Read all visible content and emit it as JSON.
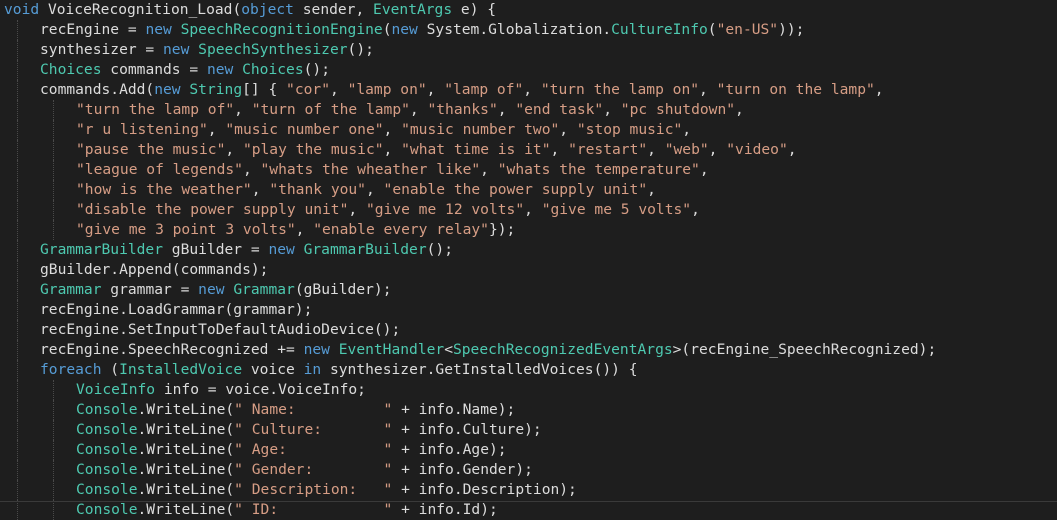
{
  "editor": {
    "theme_colors": {
      "background": "#1e1e1e",
      "keyword": "#569cd6",
      "type": "#4ec9b0",
      "string": "#d69d85",
      "text": "#dcdcdc"
    },
    "lines": [
      {
        "indent": 0,
        "tokens": [
          [
            "kw",
            "void"
          ],
          [
            "tx",
            " VoiceRecognition_Load("
          ],
          [
            "kw",
            "object"
          ],
          [
            "tx",
            " sender, "
          ],
          [
            "ty",
            "EventArgs"
          ],
          [
            "tx",
            " e) {"
          ]
        ]
      },
      {
        "indent": 1,
        "tokens": [
          [
            "tx",
            "recEngine = "
          ],
          [
            "kw",
            "new"
          ],
          [
            "tx",
            " "
          ],
          [
            "ty",
            "SpeechRecognitionEngine"
          ],
          [
            "tx",
            "("
          ],
          [
            "kw",
            "new"
          ],
          [
            "tx",
            " System.Globalization."
          ],
          [
            "ty",
            "CultureInfo"
          ],
          [
            "tx",
            "("
          ],
          [
            "st",
            "\"en-US\""
          ],
          [
            "tx",
            "));"
          ]
        ]
      },
      {
        "indent": 1,
        "tokens": [
          [
            "tx",
            "synthesizer = "
          ],
          [
            "kw",
            "new"
          ],
          [
            "tx",
            " "
          ],
          [
            "ty",
            "SpeechSynthesizer"
          ],
          [
            "tx",
            "();"
          ]
        ]
      },
      {
        "indent": 1,
        "tokens": [
          [
            "ty",
            "Choices"
          ],
          [
            "tx",
            " commands = "
          ],
          [
            "kw",
            "new"
          ],
          [
            "tx",
            " "
          ],
          [
            "ty",
            "Choices"
          ],
          [
            "tx",
            "();"
          ]
        ]
      },
      {
        "indent": 1,
        "tokens": [
          [
            "tx",
            "commands.Add("
          ],
          [
            "kw",
            "new"
          ],
          [
            "tx",
            " "
          ],
          [
            "ty",
            "String"
          ],
          [
            "tx",
            "[] { "
          ],
          [
            "st",
            "\"cor\""
          ],
          [
            "tx",
            ", "
          ],
          [
            "st",
            "\"lamp on\""
          ],
          [
            "tx",
            ", "
          ],
          [
            "st",
            "\"lamp of\""
          ],
          [
            "tx",
            ", "
          ],
          [
            "st",
            "\"turn the lamp on\""
          ],
          [
            "tx",
            ", "
          ],
          [
            "st",
            "\"turn on the lamp\""
          ],
          [
            "tx",
            ","
          ]
        ]
      },
      {
        "indent": 2,
        "tokens": [
          [
            "st",
            "\"turn the lamp of\""
          ],
          [
            "tx",
            ", "
          ],
          [
            "st",
            "\"turn of the lamp\""
          ],
          [
            "tx",
            ", "
          ],
          [
            "st",
            "\"thanks\""
          ],
          [
            "tx",
            ", "
          ],
          [
            "st",
            "\"end task\""
          ],
          [
            "tx",
            ", "
          ],
          [
            "st",
            "\"pc shutdown\""
          ],
          [
            "tx",
            ","
          ]
        ]
      },
      {
        "indent": 2,
        "tokens": [
          [
            "st",
            "\"r u listening\""
          ],
          [
            "tx",
            ", "
          ],
          [
            "st",
            "\"music number one\""
          ],
          [
            "tx",
            ", "
          ],
          [
            "st",
            "\"music number two\""
          ],
          [
            "tx",
            ", "
          ],
          [
            "st",
            "\"stop music\""
          ],
          [
            "tx",
            ","
          ]
        ]
      },
      {
        "indent": 2,
        "tokens": [
          [
            "st",
            "\"pause the music\""
          ],
          [
            "tx",
            ", "
          ],
          [
            "st",
            "\"play the music\""
          ],
          [
            "tx",
            ", "
          ],
          [
            "st",
            "\"what time is it\""
          ],
          [
            "tx",
            ", "
          ],
          [
            "st",
            "\"restart\""
          ],
          [
            "tx",
            ", "
          ],
          [
            "st",
            "\"web\""
          ],
          [
            "tx",
            ", "
          ],
          [
            "st",
            "\"video\""
          ],
          [
            "tx",
            ","
          ]
        ]
      },
      {
        "indent": 2,
        "tokens": [
          [
            "st",
            "\"league of legends\""
          ],
          [
            "tx",
            ", "
          ],
          [
            "st",
            "\"whats the wheather like\""
          ],
          [
            "tx",
            ", "
          ],
          [
            "st",
            "\"whats the temperature\""
          ],
          [
            "tx",
            ","
          ]
        ]
      },
      {
        "indent": 2,
        "tokens": [
          [
            "st",
            "\"how is the weather\""
          ],
          [
            "tx",
            ", "
          ],
          [
            "st",
            "\"thank you\""
          ],
          [
            "tx",
            ", "
          ],
          [
            "st",
            "\"enable the power supply unit\""
          ],
          [
            "tx",
            ","
          ]
        ]
      },
      {
        "indent": 2,
        "tokens": [
          [
            "st",
            "\"disable the power supply unit\""
          ],
          [
            "tx",
            ", "
          ],
          [
            "st",
            "\"give me 12 volts\""
          ],
          [
            "tx",
            ", "
          ],
          [
            "st",
            "\"give me 5 volts\""
          ],
          [
            "tx",
            ","
          ]
        ]
      },
      {
        "indent": 2,
        "tokens": [
          [
            "st",
            "\"give me 3 point 3 volts\""
          ],
          [
            "tx",
            ", "
          ],
          [
            "st",
            "\"enable every relay\""
          ],
          [
            "tx",
            "});"
          ]
        ]
      },
      {
        "indent": 1,
        "tokens": [
          [
            "ty",
            "GrammarBuilder"
          ],
          [
            "tx",
            " gBuilder = "
          ],
          [
            "kw",
            "new"
          ],
          [
            "tx",
            " "
          ],
          [
            "ty",
            "GrammarBuilder"
          ],
          [
            "tx",
            "();"
          ]
        ]
      },
      {
        "indent": 1,
        "tokens": [
          [
            "tx",
            "gBuilder.Append(commands);"
          ]
        ]
      },
      {
        "indent": 1,
        "tokens": [
          [
            "ty",
            "Grammar"
          ],
          [
            "tx",
            " grammar = "
          ],
          [
            "kw",
            "new"
          ],
          [
            "tx",
            " "
          ],
          [
            "ty",
            "Grammar"
          ],
          [
            "tx",
            "(gBuilder);"
          ]
        ]
      },
      {
        "indent": 1,
        "tokens": [
          [
            "tx",
            "recEngine.LoadGrammar(grammar);"
          ]
        ]
      },
      {
        "indent": 1,
        "tokens": [
          [
            "tx",
            "recEngine.SetInputToDefaultAudioDevice();"
          ]
        ]
      },
      {
        "indent": 1,
        "tokens": [
          [
            "tx",
            "recEngine.SpeechRecognized += "
          ],
          [
            "kw",
            "new"
          ],
          [
            "tx",
            " "
          ],
          [
            "ty",
            "EventHandler"
          ],
          [
            "tx",
            "<"
          ],
          [
            "ty",
            "SpeechRecognizedEventArgs"
          ],
          [
            "tx",
            ">(recEngine_SpeechRecognized);"
          ]
        ]
      },
      {
        "indent": 1,
        "tokens": [
          [
            "kw",
            "foreach"
          ],
          [
            "tx",
            " ("
          ],
          [
            "ty",
            "InstalledVoice"
          ],
          [
            "tx",
            " voice "
          ],
          [
            "kw",
            "in"
          ],
          [
            "tx",
            " synthesizer.GetInstalledVoices()) {"
          ]
        ]
      },
      {
        "indent": 2,
        "tokens": [
          [
            "ty",
            "VoiceInfo"
          ],
          [
            "tx",
            " info = voice.VoiceInfo;"
          ]
        ]
      },
      {
        "indent": 2,
        "tokens": [
          [
            "ty",
            "Console"
          ],
          [
            "tx",
            ".WriteLine("
          ],
          [
            "st",
            "\" Name:          \""
          ],
          [
            "tx",
            " + info.Name);"
          ]
        ]
      },
      {
        "indent": 2,
        "tokens": [
          [
            "ty",
            "Console"
          ],
          [
            "tx",
            ".WriteLine("
          ],
          [
            "st",
            "\" Culture:       \""
          ],
          [
            "tx",
            " + info.Culture);"
          ]
        ]
      },
      {
        "indent": 2,
        "tokens": [
          [
            "ty",
            "Console"
          ],
          [
            "tx",
            ".WriteLine("
          ],
          [
            "st",
            "\" Age:           \""
          ],
          [
            "tx",
            " + info.Age);"
          ]
        ]
      },
      {
        "indent": 2,
        "tokens": [
          [
            "ty",
            "Console"
          ],
          [
            "tx",
            ".WriteLine("
          ],
          [
            "st",
            "\" Gender:        \""
          ],
          [
            "tx",
            " + info.Gender);"
          ]
        ]
      },
      {
        "indent": 2,
        "tokens": [
          [
            "ty",
            "Console"
          ],
          [
            "tx",
            ".WriteLine("
          ],
          [
            "st",
            "\" Description:   \""
          ],
          [
            "tx",
            " + info.Description);"
          ]
        ]
      },
      {
        "indent": 2,
        "tokens": [
          [
            "ty",
            "Console"
          ],
          [
            "tx",
            ".WriteLine("
          ],
          [
            "st",
            "\" ID:            \""
          ],
          [
            "tx",
            " + info.Id);"
          ]
        ]
      }
    ]
  }
}
